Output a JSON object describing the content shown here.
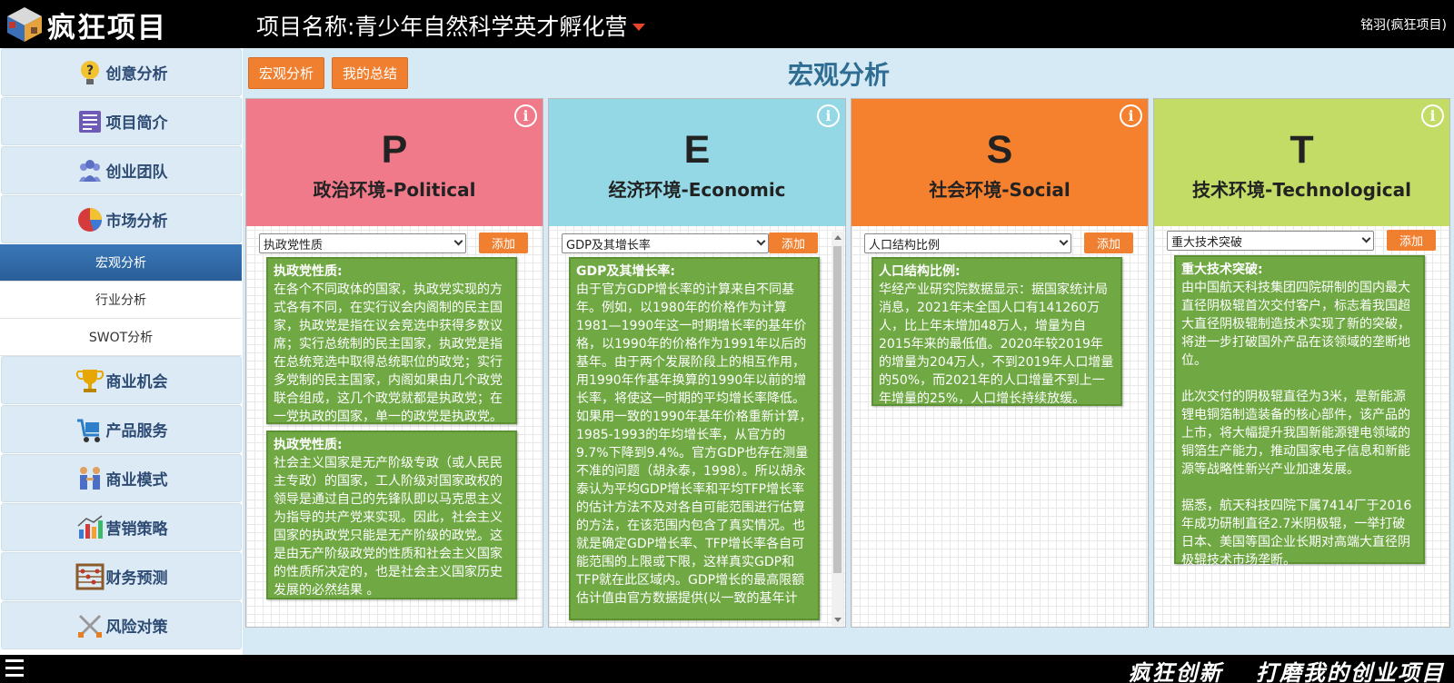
{
  "header": {
    "logo_text": "疯狂项目",
    "project_title": "项目名称:青少年自然科学英才孵化营",
    "user": "铭羽(疯狂项目)"
  },
  "sidebar": {
    "items": [
      {
        "label": "创意分析",
        "icon": "lightbulb-question-icon"
      },
      {
        "label": "项目简介",
        "icon": "document-icon"
      },
      {
        "label": "创业团队",
        "icon": "team-icon"
      },
      {
        "label": "市场分析",
        "icon": "pie-chart-icon"
      }
    ],
    "sub_items": [
      {
        "label": "宏观分析",
        "active": true
      },
      {
        "label": "行业分析",
        "active": false
      },
      {
        "label": "SWOT分析",
        "active": false
      }
    ],
    "items_after": [
      {
        "label": "商业机会",
        "icon": "trophy-icon"
      },
      {
        "label": "产品服务",
        "icon": "cart-icon"
      },
      {
        "label": "商业模式",
        "icon": "handshake-icon"
      },
      {
        "label": "营销策略",
        "icon": "bar-chart-icon"
      },
      {
        "label": "财务预测",
        "icon": "abacus-icon"
      },
      {
        "label": "风险对策",
        "icon": "crossed-swords-icon"
      }
    ]
  },
  "main": {
    "tabs": [
      "宏观分析",
      "我的总结"
    ],
    "heading": "宏观分析",
    "columns": [
      {
        "letter": "P",
        "title": "政治环境-Political",
        "color": "#f07a8a",
        "select": "执政党性质",
        "add": "添加",
        "cards": [
          {
            "title": "执政党性质:",
            "paras": [
              "在各个不同政体的国家，执政党实现的方式各有不同，在实行议会内阁制的民主国家，执政党是指在议会竞选中获得多数议席；实行总统制的民主国家，执政党是指在总统竞选中取得总统职位的政党；实行多党制的民主国家，内阁如果由几个政党联合组成，这几个政党就都是执政党；在一党执政的国家，单一的政党是执政党。"
            ]
          },
          {
            "title": "执政党性质:",
            "paras": [
              "社会主义国家是无产阶级专政（或人民民主专政）的国家，工人阶级对国家政权的领导是通过自己的先锋队即以马克思主义为指导的共产党来实现。因此，社会主义国家的执政党只能是无产阶级的政党。这是由无产阶级政党的性质和社会主义国家的性质所决定的，也是社会主义国家历史发展的必然结果 。"
            ]
          }
        ]
      },
      {
        "letter": "E",
        "title": "经济环境-Economic",
        "color": "#93d8e4",
        "select": "GDP及其增长率",
        "add": "添加",
        "cards": [
          {
            "title": "GDP及其增长率:",
            "paras": [
              "由于官方GDP增长率的计算来自不同基年。例如，以1980年的价格作为计算1981—1990年这一时期增长率的基年价格，以1990年的价格作为1991年以后的基年。由于两个发展阶段上的相互作用，用1990年作基年换算的1990年以前的增长率，将使这一时期的平均增长率降低。如果用一致的1990年基年价格重新计算，1985-1993的年均增长率，从官方的9.7%下降到9.4%。官方GDP也存在测量不准的问题（胡永泰，1998）。所以胡永泰认为平均GDP增长率和平均TFP增长率的估计方法不及对各自可能范围进行估算的方法，在该范围内包含了真实情况。也就是确定GDP增长率、TFP增长率各自可能范围的上限或下限，这样真实GDP和TFP就在此区域内。GDP增长的最高限额估计值由官方数据提供(以一致的基年计"
            ]
          }
        ]
      },
      {
        "letter": "S",
        "title": "社会环境-Social",
        "color": "#f5812f",
        "select": "人口结构比例",
        "add": "添加",
        "cards": [
          {
            "title": "人口结构比例:",
            "paras": [
              "华经产业研究院数据显示：据国家统计局消息，2021年末全国人口有141260万人，比上年末增加48万人，增量为自2015年来的最低值。2020年较2019年的增量为204万人，不到2019年人口增量的50%，而2021年的人口增量不到上一年增量的25%，人口增长持续放缓。"
            ]
          }
        ]
      },
      {
        "letter": "T",
        "title": "技术环境-Technological",
        "color": "#c2dc66",
        "select": "重大技术突破",
        "add": "添加",
        "cards": [
          {
            "title": "重大技术突破:",
            "paras": [
              "由中国航天科技集团四院研制的国内最大直径阴极辊首次交付客户，标志着我国超大直径阴极辊制造技术实现了新的突破，将进一步打破国外产品在该领域的垄断地位。",
              "此次交付的阴极辊直径为3米，是新能源锂电铜箔制造装备的核心部件，该产品的上市，将大幅提升我国新能源锂电领域的铜箔生产能力，推动国家电子信息和新能源等战略性新兴产业加速发展。",
              "据悉，航天科技四院下属7414厂于2016年成功研制直径2.7米阴极辊，一举打破日本、美国等国企业长期对高端大直径阴极辊技术市场垄断。"
            ]
          }
        ]
      }
    ]
  },
  "footer": {
    "slogan": "疯狂创新　 打磨我的创业项目"
  }
}
